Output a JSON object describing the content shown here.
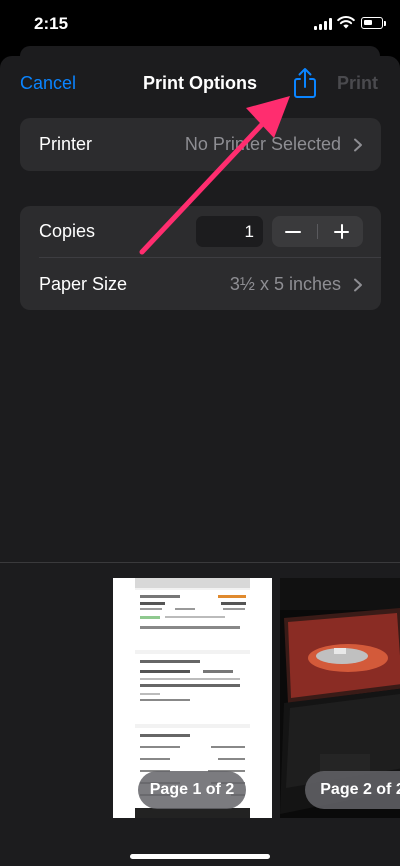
{
  "status_bar": {
    "time": "2:15"
  },
  "nav": {
    "cancel_label": "Cancel",
    "title": "Print Options",
    "print_label": "Print",
    "share_icon": "share-icon"
  },
  "printer_row": {
    "label": "Printer",
    "value": "No Printer Selected"
  },
  "copies_row": {
    "label": "Copies",
    "value": "1"
  },
  "paper_row": {
    "label": "Paper Size",
    "value": "3½ x 5 inches"
  },
  "preview": {
    "pages": [
      {
        "badge": "Page 1 of 2"
      },
      {
        "badge": "Page 2 of 2"
      }
    ]
  },
  "annotation": {
    "color": "#ff2d6f"
  },
  "colors": {
    "accent": "#0a84ff",
    "sheet": "#1c1c1e",
    "group": "#2c2c2e"
  }
}
